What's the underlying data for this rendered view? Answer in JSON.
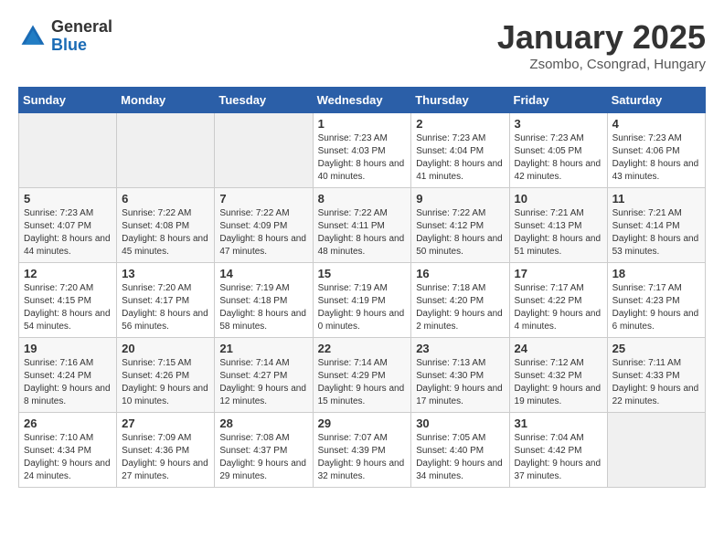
{
  "header": {
    "logo_general": "General",
    "logo_blue": "Blue",
    "title": "January 2025",
    "location": "Zsombo, Csongrad, Hungary"
  },
  "weekdays": [
    "Sunday",
    "Monday",
    "Tuesday",
    "Wednesday",
    "Thursday",
    "Friday",
    "Saturday"
  ],
  "weeks": [
    [
      {
        "day": "",
        "sunrise": "",
        "sunset": "",
        "daylight": ""
      },
      {
        "day": "",
        "sunrise": "",
        "sunset": "",
        "daylight": ""
      },
      {
        "day": "",
        "sunrise": "",
        "sunset": "",
        "daylight": ""
      },
      {
        "day": "1",
        "sunrise": "Sunrise: 7:23 AM",
        "sunset": "Sunset: 4:03 PM",
        "daylight": "Daylight: 8 hours and 40 minutes."
      },
      {
        "day": "2",
        "sunrise": "Sunrise: 7:23 AM",
        "sunset": "Sunset: 4:04 PM",
        "daylight": "Daylight: 8 hours and 41 minutes."
      },
      {
        "day": "3",
        "sunrise": "Sunrise: 7:23 AM",
        "sunset": "Sunset: 4:05 PM",
        "daylight": "Daylight: 8 hours and 42 minutes."
      },
      {
        "day": "4",
        "sunrise": "Sunrise: 7:23 AM",
        "sunset": "Sunset: 4:06 PM",
        "daylight": "Daylight: 8 hours and 43 minutes."
      }
    ],
    [
      {
        "day": "5",
        "sunrise": "Sunrise: 7:23 AM",
        "sunset": "Sunset: 4:07 PM",
        "daylight": "Daylight: 8 hours and 44 minutes."
      },
      {
        "day": "6",
        "sunrise": "Sunrise: 7:22 AM",
        "sunset": "Sunset: 4:08 PM",
        "daylight": "Daylight: 8 hours and 45 minutes."
      },
      {
        "day": "7",
        "sunrise": "Sunrise: 7:22 AM",
        "sunset": "Sunset: 4:09 PM",
        "daylight": "Daylight: 8 hours and 47 minutes."
      },
      {
        "day": "8",
        "sunrise": "Sunrise: 7:22 AM",
        "sunset": "Sunset: 4:11 PM",
        "daylight": "Daylight: 8 hours and 48 minutes."
      },
      {
        "day": "9",
        "sunrise": "Sunrise: 7:22 AM",
        "sunset": "Sunset: 4:12 PM",
        "daylight": "Daylight: 8 hours and 50 minutes."
      },
      {
        "day": "10",
        "sunrise": "Sunrise: 7:21 AM",
        "sunset": "Sunset: 4:13 PM",
        "daylight": "Daylight: 8 hours and 51 minutes."
      },
      {
        "day": "11",
        "sunrise": "Sunrise: 7:21 AM",
        "sunset": "Sunset: 4:14 PM",
        "daylight": "Daylight: 8 hours and 53 minutes."
      }
    ],
    [
      {
        "day": "12",
        "sunrise": "Sunrise: 7:20 AM",
        "sunset": "Sunset: 4:15 PM",
        "daylight": "Daylight: 8 hours and 54 minutes."
      },
      {
        "day": "13",
        "sunrise": "Sunrise: 7:20 AM",
        "sunset": "Sunset: 4:17 PM",
        "daylight": "Daylight: 8 hours and 56 minutes."
      },
      {
        "day": "14",
        "sunrise": "Sunrise: 7:19 AM",
        "sunset": "Sunset: 4:18 PM",
        "daylight": "Daylight: 8 hours and 58 minutes."
      },
      {
        "day": "15",
        "sunrise": "Sunrise: 7:19 AM",
        "sunset": "Sunset: 4:19 PM",
        "daylight": "Daylight: 9 hours and 0 minutes."
      },
      {
        "day": "16",
        "sunrise": "Sunrise: 7:18 AM",
        "sunset": "Sunset: 4:20 PM",
        "daylight": "Daylight: 9 hours and 2 minutes."
      },
      {
        "day": "17",
        "sunrise": "Sunrise: 7:17 AM",
        "sunset": "Sunset: 4:22 PM",
        "daylight": "Daylight: 9 hours and 4 minutes."
      },
      {
        "day": "18",
        "sunrise": "Sunrise: 7:17 AM",
        "sunset": "Sunset: 4:23 PM",
        "daylight": "Daylight: 9 hours and 6 minutes."
      }
    ],
    [
      {
        "day": "19",
        "sunrise": "Sunrise: 7:16 AM",
        "sunset": "Sunset: 4:24 PM",
        "daylight": "Daylight: 9 hours and 8 minutes."
      },
      {
        "day": "20",
        "sunrise": "Sunrise: 7:15 AM",
        "sunset": "Sunset: 4:26 PM",
        "daylight": "Daylight: 9 hours and 10 minutes."
      },
      {
        "day": "21",
        "sunrise": "Sunrise: 7:14 AM",
        "sunset": "Sunset: 4:27 PM",
        "daylight": "Daylight: 9 hours and 12 minutes."
      },
      {
        "day": "22",
        "sunrise": "Sunrise: 7:14 AM",
        "sunset": "Sunset: 4:29 PM",
        "daylight": "Daylight: 9 hours and 15 minutes."
      },
      {
        "day": "23",
        "sunrise": "Sunrise: 7:13 AM",
        "sunset": "Sunset: 4:30 PM",
        "daylight": "Daylight: 9 hours and 17 minutes."
      },
      {
        "day": "24",
        "sunrise": "Sunrise: 7:12 AM",
        "sunset": "Sunset: 4:32 PM",
        "daylight": "Daylight: 9 hours and 19 minutes."
      },
      {
        "day": "25",
        "sunrise": "Sunrise: 7:11 AM",
        "sunset": "Sunset: 4:33 PM",
        "daylight": "Daylight: 9 hours and 22 minutes."
      }
    ],
    [
      {
        "day": "26",
        "sunrise": "Sunrise: 7:10 AM",
        "sunset": "Sunset: 4:34 PM",
        "daylight": "Daylight: 9 hours and 24 minutes."
      },
      {
        "day": "27",
        "sunrise": "Sunrise: 7:09 AM",
        "sunset": "Sunset: 4:36 PM",
        "daylight": "Daylight: 9 hours and 27 minutes."
      },
      {
        "day": "28",
        "sunrise": "Sunrise: 7:08 AM",
        "sunset": "Sunset: 4:37 PM",
        "daylight": "Daylight: 9 hours and 29 minutes."
      },
      {
        "day": "29",
        "sunrise": "Sunrise: 7:07 AM",
        "sunset": "Sunset: 4:39 PM",
        "daylight": "Daylight: 9 hours and 32 minutes."
      },
      {
        "day": "30",
        "sunrise": "Sunrise: 7:05 AM",
        "sunset": "Sunset: 4:40 PM",
        "daylight": "Daylight: 9 hours and 34 minutes."
      },
      {
        "day": "31",
        "sunrise": "Sunrise: 7:04 AM",
        "sunset": "Sunset: 4:42 PM",
        "daylight": "Daylight: 9 hours and 37 minutes."
      },
      {
        "day": "",
        "sunrise": "",
        "sunset": "",
        "daylight": ""
      }
    ]
  ]
}
